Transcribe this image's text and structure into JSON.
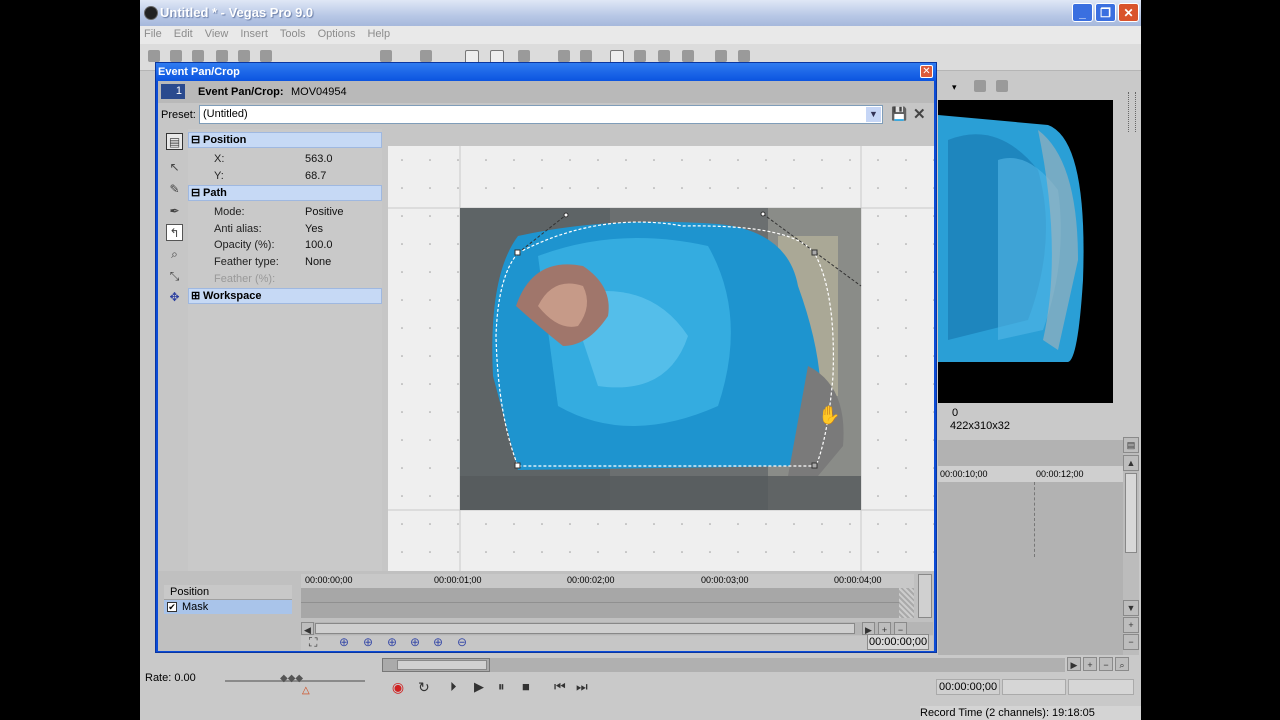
{
  "app": {
    "title": "Untitled * - Vegas Pro 9.0",
    "menu": [
      "File",
      "Edit",
      "View",
      "Insert",
      "Tools",
      "Options",
      "Help"
    ],
    "colors": {
      "titlebar": "#b8c8e6",
      "dialog_border": "#0b4bd6",
      "panel_header": "#c6d9f5"
    }
  },
  "dialog": {
    "title": "Event Pan/Crop",
    "track_number": "1",
    "header_label": "Event Pan/Crop:",
    "header_value": "MOV04954",
    "preset_label": "Preset:",
    "preset_value": "(Untitled)"
  },
  "properties": {
    "position": {
      "header": "Position",
      "x_label": "X:",
      "x_value": "563.0",
      "y_label": "Y:",
      "y_value": "68.7"
    },
    "path": {
      "header": "Path",
      "rows": [
        {
          "label": "Mode:",
          "value": "Positive"
        },
        {
          "label": "Anti alias:",
          "value": "Yes"
        },
        {
          "label": "Opacity (%):",
          "value": "100.0"
        },
        {
          "label": "Feather type:",
          "value": "None"
        },
        {
          "label": "Feather (%):",
          "value": ""
        }
      ]
    },
    "workspace": {
      "header": "Workspace"
    }
  },
  "tools": [
    "properties-icon",
    "normal-edit-icon",
    "anchor-icon",
    "anchor-add-icon",
    "anchor-delete-icon",
    "split-icon",
    "zoom-icon",
    "rotate-icon",
    "move-icon"
  ],
  "keyframes": {
    "tracks": [
      {
        "label": "Position",
        "checked": false
      },
      {
        "label": "Mask",
        "checked": true
      }
    ],
    "ruler": [
      "00:00:00;00",
      "00:00:01;00",
      "00:00:02;00",
      "00:00:03;00",
      "00:00:04;00"
    ],
    "time_readout": "00:00:00;00"
  },
  "main": {
    "preview_info_1": "0",
    "preview_info_2": "422x310x32",
    "timeline_ruler": [
      "00:00:10;00",
      "00:00:12;00"
    ],
    "rate": "Rate: 0.00",
    "transport_time": "00:00:00;00",
    "status": "Record Time (2 channels): 19:18:05"
  }
}
